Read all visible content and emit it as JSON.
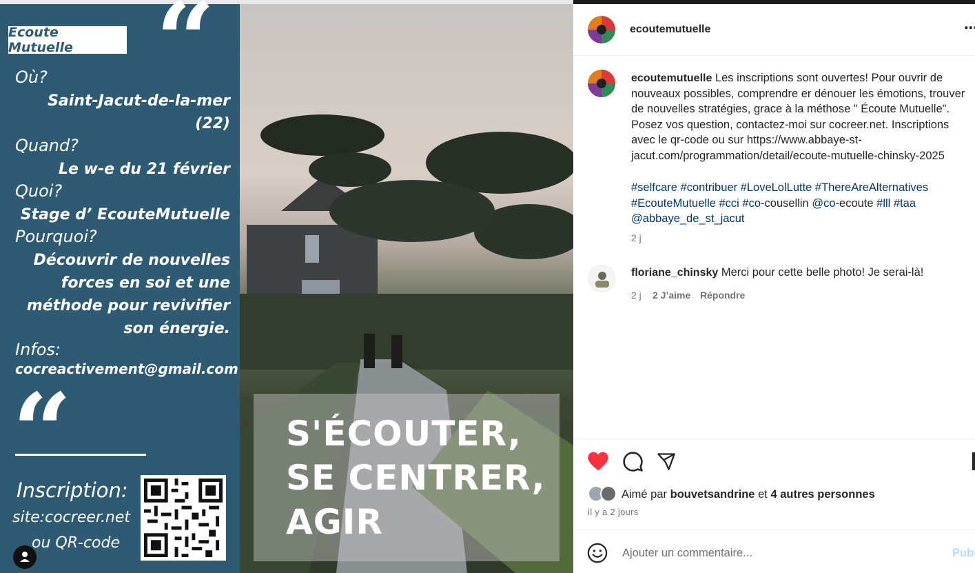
{
  "poster": {
    "tag": "Ecoute Mutuelle",
    "where_q": "Où?",
    "where_a1": "Saint-Jacut-de-la-mer",
    "where_a2": "(22)",
    "when_q": "Quand?",
    "when_a": "Le w-e du 21 février",
    "what_q": "Quoi?",
    "what_a": "Stage d’ EcouteMutuelle",
    "why_q": "Pourquoi?",
    "why_a1": "Découvrir de nouvelles",
    "why_a2": "forces en soi et une",
    "why_a3": "méthode pour revivifier",
    "why_a4": "son énergie.",
    "info_q": "Infos:",
    "email": "cocreactivement@gmail.com",
    "inscription": "Inscription:",
    "site": "site:cocreer.net",
    "or_qr": "ou QR-code",
    "slogan1": "S'ÉCOUTER,",
    "slogan2": "SE  CENTRER,",
    "slogan3": "AGIR",
    "panel_color": "#2e5a73"
  },
  "post": {
    "username": "ecoutemutuelle",
    "more_icon": "more-icon",
    "caption_user": "ecoutemutuelle",
    "caption_text": "Les inscriptions sont ouvertes! Pour ouvrir de nouveaux possibles, comprendre er dénouer les émotions, trouver de nouvelles stratégies, grace à la méthose \" Écoute Mutuelle\". Posez vos question, contactez-moi sur cocreer.net. Inscriptions avec le qr-code ou sur https://www.abbaye-st-jacut.com/programmation/detail/ecoute-mutuelle-chinsky-2025",
    "hashtags_line1": "#selfcare #contribuer #LoveLolLutte #ThereAreAlternatives",
    "hashtags_line2": "#EcouteMutuelle #cci #co-",
    "hashtags_plain": "cousellin",
    "mention_co": " @co-",
    "mention_plain": "ecoute",
    "hashtags_line2b": " #lll #taa",
    "mention_abbaye": "@abbaye_de_st_jacut",
    "caption_time": "2 j",
    "comment_user": "floriane_chinsky",
    "comment_text": "Merci pour cette belle photo! Je serai-là!",
    "comment_time": "2 j",
    "comment_likes": "2 J’aime",
    "reply": "Répondre",
    "liked_prefix": "Aimé par",
    "liked_user": "bouvetsandrine",
    "liked_and": "et",
    "liked_others": "4 autres personnes",
    "posted_ago": "il y a 2 jours",
    "comment_placeholder": "Ajouter un commentaire...",
    "publish": "Publier",
    "heart_color": "#ff3040",
    "link_color": "#00376b"
  }
}
